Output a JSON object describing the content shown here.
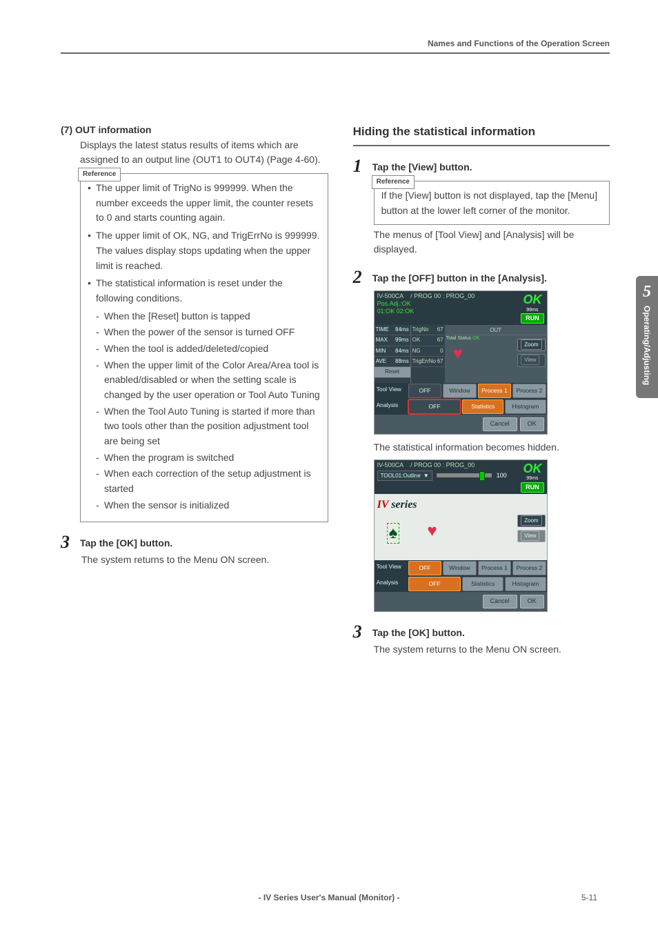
{
  "header": {
    "running_title": "Names and Functions of the Operation Screen"
  },
  "side_tab": {
    "number": "5",
    "title": "Operating/Adjusting"
  },
  "left": {
    "item7_label": "(7)",
    "item7_title": "OUT information",
    "item7_body": "Displays the latest status results of items which are assigned to an output line (OUT1 to OUT4) (Page 4-60).",
    "reference_label": "Reference",
    "ref_bullets": [
      "The upper limit of TrigNo is 999999. When the number exceeds the upper limit, the counter resets to 0 and starts counting again.",
      "The upper limit of OK, NG, and TrigErrNo is 999999. The values display stops updating when the upper limit is reached.",
      "The statistical information is reset under the following conditions."
    ],
    "ref_sublist": [
      "When the [Reset] button is tapped",
      "When the power of the sensor is turned OFF",
      "When the tool is added/deleted/copied",
      "When the upper limit of the Color Area/Area tool is enabled/disabled or when the setting scale is changed by the user operation or Tool Auto Tuning",
      "When the Tool Auto Tuning is started if more than two tools other than the position adjustment tool are being set",
      "When the program is switched",
      "When each correction of the setup adjustment is started",
      "When the sensor is initialized"
    ],
    "step3_num": "3",
    "step3_title": "Tap the [OK] button.",
    "step3_body": "The system returns to the Menu ON screen."
  },
  "right": {
    "section_title": "Hiding the statistical information",
    "step1_num": "1",
    "step1_title": "Tap the [View] button.",
    "reference_label": "Reference",
    "ref1_body": "If the [View] button is not displayed, tap the [Menu] button at the lower left corner of the monitor.",
    "step1_body": "The menus of [Tool View] and [Analysis] will be displayed.",
    "step2_num": "2",
    "step2_title": "Tap the [OFF] button in the [Analysis].",
    "step2_after": "The statistical information becomes hidden.",
    "step3_num": "3",
    "step3_title": "Tap the [OK] button.",
    "step3_body": "The system returns to the Menu ON screen.",
    "ss": {
      "model": "IV-500CA",
      "prog": "/   PROG 00 : PROG_00",
      "pos_adj": "Pos.Adj.:OK",
      "row01": "01:OK 02:OK",
      "ok": "OK",
      "ms": "99ms",
      "run": "RUN",
      "time_lbl": "TIME",
      "time_v": "84ms",
      "max_lbl": "MAX",
      "max_v": "99ms",
      "min_lbl": "MIN",
      "min_v": "84ms",
      "ave_lbl": "AVE",
      "ave_v": "88ms",
      "reset": "Reset",
      "trigno_lbl": "TrigNo",
      "trigno_v": "67",
      "ok_lbl": "OK",
      "ok_v": "67",
      "ng_lbl": "NG",
      "ng_v": "0",
      "trigerr_lbl": "TrigErrNo",
      "trigerr_v": "67",
      "out_lbl": "OUT",
      "total_status": "Total Status",
      "total_status_v": "OK",
      "zoom": "Zoom",
      "view": "View",
      "toolview": "Tool View",
      "off": "OFF",
      "window": "Window",
      "process1": "Process 1",
      "process2": "Process 2",
      "analysis": "Analysis",
      "statistics": "Statistics",
      "histogram": "Histogram",
      "cancel": "Cancel",
      "okbtn": "OK",
      "tool01": "TOOL01:Outline",
      "slider_val": "100",
      "iv_series": "series"
    }
  },
  "footer": {
    "manual": "- IV Series User's Manual (Monitor) -",
    "page": "5-11"
  }
}
